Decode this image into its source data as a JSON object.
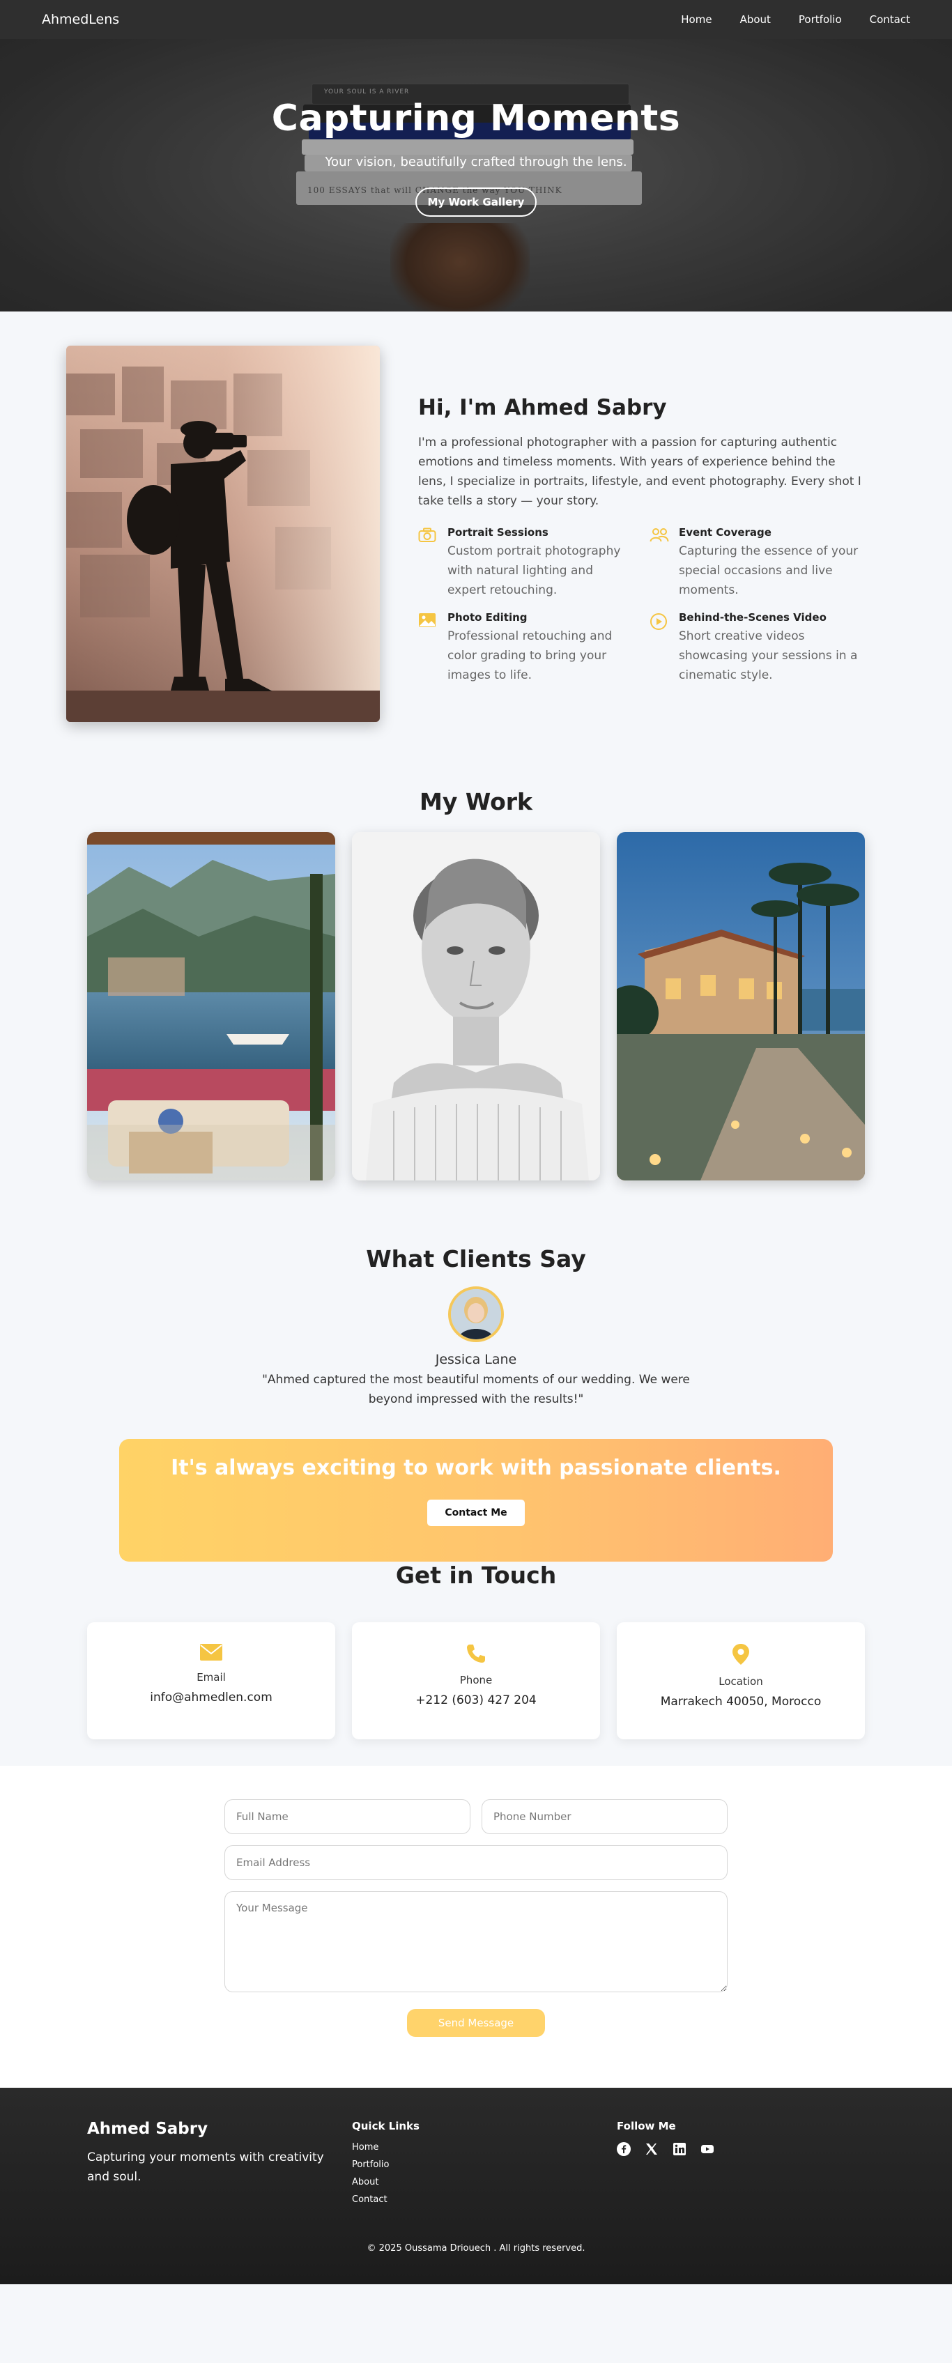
{
  "nav": {
    "brand": "AhmedLens",
    "links": [
      "Home",
      "About",
      "Portfolio",
      "Contact"
    ]
  },
  "hero": {
    "title": "Capturing Moments",
    "subtitle": "Your vision, beautifully crafted through the lens.",
    "button": "My Work Gallery",
    "book_spines": [
      "YOUR SOUL IS A RIVER",
      "100 ESSAYS that will CHANGE the way YOU THINK"
    ]
  },
  "about": {
    "title": "Hi, I'm Ahmed Sabry",
    "paragraph": "I'm a professional photographer with a passion for capturing authentic emotions and timeless moments. With years of experience behind the lens, I specialize in portraits, lifestyle, and event photography. Every shot I take tells a story — your story.",
    "services": [
      {
        "icon": "camera-icon",
        "title": "Portrait Sessions",
        "desc": "Custom portrait photography with natural lighting and expert retouching."
      },
      {
        "icon": "people-icon",
        "title": "Event Coverage",
        "desc": "Capturing the essence of your special occasions and live moments."
      },
      {
        "icon": "image-icon",
        "title": "Photo Editing",
        "desc": "Professional retouching and color grading to bring your images to life."
      },
      {
        "icon": "play-icon",
        "title": "Behind-the-Scenes Video",
        "desc": "Short creative videos showcasing your sessions in a cinematic style."
      }
    ]
  },
  "work": {
    "title": "My Work"
  },
  "testimonial": {
    "title": "What Clients Say",
    "name": "Jessica Lane",
    "quote": "\"Ahmed captured the most beautiful moments of our wedding. We were beyond impressed with the results!\""
  },
  "cta": {
    "title": "It's always exciting to work with passionate clients.",
    "button": "Contact Me"
  },
  "contact": {
    "title": "Get in Touch",
    "cards": [
      {
        "icon": "envelope-icon",
        "label": "Email",
        "value": "info@ahmedlen.com"
      },
      {
        "icon": "phone-icon",
        "label": "Phone",
        "value": "+212 (603) 427 204"
      },
      {
        "icon": "location-pin-icon",
        "label": "Location",
        "value": "Marrakech 40050, Morocco"
      }
    ]
  },
  "form": {
    "name_placeholder": "Full Name",
    "phone_placeholder": "Phone Number",
    "email_placeholder": "Email Address",
    "message_placeholder": "Your Message",
    "submit": "Send Message"
  },
  "footer": {
    "name": "Ahmed Sabry",
    "tagline": "Capturing your moments with creativity and soul.",
    "quick_links_title": "Quick Links",
    "quick_links": [
      "Home",
      "Portfolio",
      "About",
      "Contact"
    ],
    "follow_title": "Follow Me",
    "socials": [
      "facebook-icon",
      "x-icon",
      "linkedin-icon",
      "youtube-icon"
    ],
    "copyright": "© 2025  Oussama Driouech  . All rights reserved."
  },
  "colors": {
    "accent": "#f5c542",
    "nav_bg": "#2f2f2f",
    "cta_start": "#ffd366",
    "cta_end": "#ffae74"
  }
}
